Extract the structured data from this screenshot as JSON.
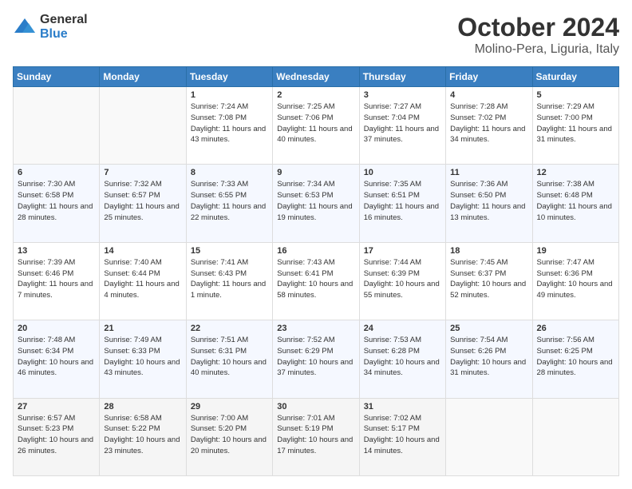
{
  "logo": {
    "general": "General",
    "blue": "Blue"
  },
  "title": "October 2024",
  "subtitle": "Molino-Pera, Liguria, Italy",
  "days_header": [
    "Sunday",
    "Monday",
    "Tuesday",
    "Wednesday",
    "Thursday",
    "Friday",
    "Saturday"
  ],
  "weeks": [
    [
      {
        "day": "",
        "info": ""
      },
      {
        "day": "",
        "info": ""
      },
      {
        "day": "1",
        "info": "Sunrise: 7:24 AM\nSunset: 7:08 PM\nDaylight: 11 hours and 43 minutes."
      },
      {
        "day": "2",
        "info": "Sunrise: 7:25 AM\nSunset: 7:06 PM\nDaylight: 11 hours and 40 minutes."
      },
      {
        "day": "3",
        "info": "Sunrise: 7:27 AM\nSunset: 7:04 PM\nDaylight: 11 hours and 37 minutes."
      },
      {
        "day": "4",
        "info": "Sunrise: 7:28 AM\nSunset: 7:02 PM\nDaylight: 11 hours and 34 minutes."
      },
      {
        "day": "5",
        "info": "Sunrise: 7:29 AM\nSunset: 7:00 PM\nDaylight: 11 hours and 31 minutes."
      }
    ],
    [
      {
        "day": "6",
        "info": "Sunrise: 7:30 AM\nSunset: 6:58 PM\nDaylight: 11 hours and 28 minutes."
      },
      {
        "day": "7",
        "info": "Sunrise: 7:32 AM\nSunset: 6:57 PM\nDaylight: 11 hours and 25 minutes."
      },
      {
        "day": "8",
        "info": "Sunrise: 7:33 AM\nSunset: 6:55 PM\nDaylight: 11 hours and 22 minutes."
      },
      {
        "day": "9",
        "info": "Sunrise: 7:34 AM\nSunset: 6:53 PM\nDaylight: 11 hours and 19 minutes."
      },
      {
        "day": "10",
        "info": "Sunrise: 7:35 AM\nSunset: 6:51 PM\nDaylight: 11 hours and 16 minutes."
      },
      {
        "day": "11",
        "info": "Sunrise: 7:36 AM\nSunset: 6:50 PM\nDaylight: 11 hours and 13 minutes."
      },
      {
        "day": "12",
        "info": "Sunrise: 7:38 AM\nSunset: 6:48 PM\nDaylight: 11 hours and 10 minutes."
      }
    ],
    [
      {
        "day": "13",
        "info": "Sunrise: 7:39 AM\nSunset: 6:46 PM\nDaylight: 11 hours and 7 minutes."
      },
      {
        "day": "14",
        "info": "Sunrise: 7:40 AM\nSunset: 6:44 PM\nDaylight: 11 hours and 4 minutes."
      },
      {
        "day": "15",
        "info": "Sunrise: 7:41 AM\nSunset: 6:43 PM\nDaylight: 11 hours and 1 minute."
      },
      {
        "day": "16",
        "info": "Sunrise: 7:43 AM\nSunset: 6:41 PM\nDaylight: 10 hours and 58 minutes."
      },
      {
        "day": "17",
        "info": "Sunrise: 7:44 AM\nSunset: 6:39 PM\nDaylight: 10 hours and 55 minutes."
      },
      {
        "day": "18",
        "info": "Sunrise: 7:45 AM\nSunset: 6:37 PM\nDaylight: 10 hours and 52 minutes."
      },
      {
        "day": "19",
        "info": "Sunrise: 7:47 AM\nSunset: 6:36 PM\nDaylight: 10 hours and 49 minutes."
      }
    ],
    [
      {
        "day": "20",
        "info": "Sunrise: 7:48 AM\nSunset: 6:34 PM\nDaylight: 10 hours and 46 minutes."
      },
      {
        "day": "21",
        "info": "Sunrise: 7:49 AM\nSunset: 6:33 PM\nDaylight: 10 hours and 43 minutes."
      },
      {
        "day": "22",
        "info": "Sunrise: 7:51 AM\nSunset: 6:31 PM\nDaylight: 10 hours and 40 minutes."
      },
      {
        "day": "23",
        "info": "Sunrise: 7:52 AM\nSunset: 6:29 PM\nDaylight: 10 hours and 37 minutes."
      },
      {
        "day": "24",
        "info": "Sunrise: 7:53 AM\nSunset: 6:28 PM\nDaylight: 10 hours and 34 minutes."
      },
      {
        "day": "25",
        "info": "Sunrise: 7:54 AM\nSunset: 6:26 PM\nDaylight: 10 hours and 31 minutes."
      },
      {
        "day": "26",
        "info": "Sunrise: 7:56 AM\nSunset: 6:25 PM\nDaylight: 10 hours and 28 minutes."
      }
    ],
    [
      {
        "day": "27",
        "info": "Sunrise: 6:57 AM\nSunset: 5:23 PM\nDaylight: 10 hours and 26 minutes."
      },
      {
        "day": "28",
        "info": "Sunrise: 6:58 AM\nSunset: 5:22 PM\nDaylight: 10 hours and 23 minutes."
      },
      {
        "day": "29",
        "info": "Sunrise: 7:00 AM\nSunset: 5:20 PM\nDaylight: 10 hours and 20 minutes."
      },
      {
        "day": "30",
        "info": "Sunrise: 7:01 AM\nSunset: 5:19 PM\nDaylight: 10 hours and 17 minutes."
      },
      {
        "day": "31",
        "info": "Sunrise: 7:02 AM\nSunset: 5:17 PM\nDaylight: 10 hours and 14 minutes."
      },
      {
        "day": "",
        "info": ""
      },
      {
        "day": "",
        "info": ""
      }
    ]
  ]
}
